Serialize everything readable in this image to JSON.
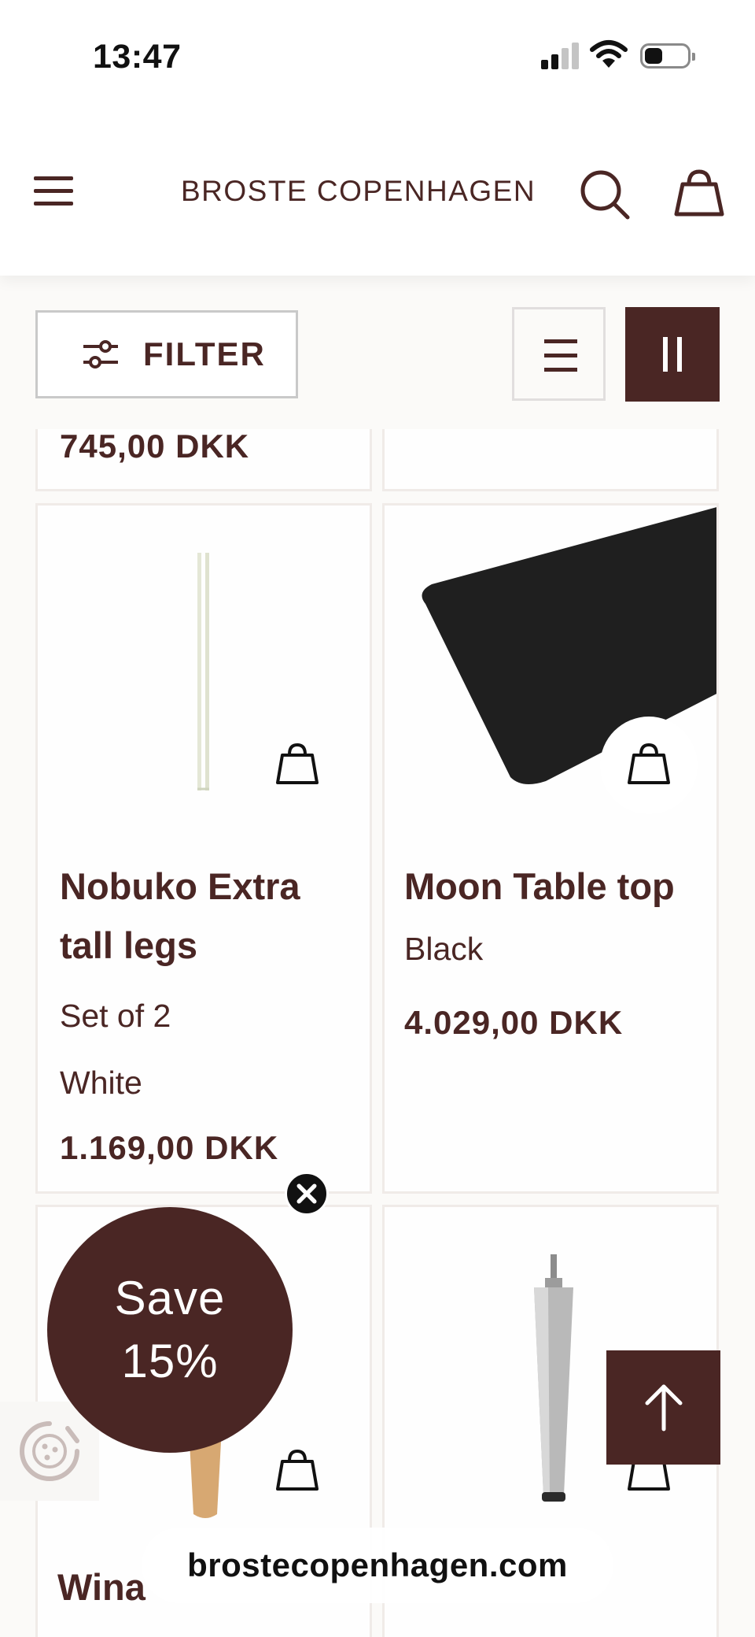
{
  "status_bar": {
    "time": "13:47"
  },
  "header": {
    "brand": "BROSTE COPENHAGEN"
  },
  "toolbar": {
    "filter_label": "FILTER"
  },
  "products": [
    {
      "title": "",
      "price": "745,00 DKK"
    },
    {
      "title": "",
      "price": ""
    },
    {
      "title_lines": [
        "Nobuko Extra",
        "tall legs"
      ],
      "details": [
        "Set of 2",
        "White"
      ],
      "price": "1.169,00 DKK"
    },
    {
      "title_lines": [
        "Moon Table top"
      ],
      "details": [
        "Black"
      ],
      "price": "4.029,00 DKK"
    },
    {
      "title_partial": "Wina"
    },
    {
      "title_partial": ""
    }
  ],
  "promo": {
    "line1": "Save",
    "line2": "15%"
  },
  "browser": {
    "url": "brostecopenhagen.com"
  },
  "colors": {
    "brand": "#4a2624",
    "background": "#fbfaf8"
  },
  "icons": [
    "menu-icon",
    "search-icon",
    "shopping-bag-icon",
    "filter-sliders-icon",
    "list-view-icon",
    "grid-view-icon",
    "add-to-cart-icon",
    "close-icon",
    "cookie-icon",
    "arrow-up-icon"
  ]
}
